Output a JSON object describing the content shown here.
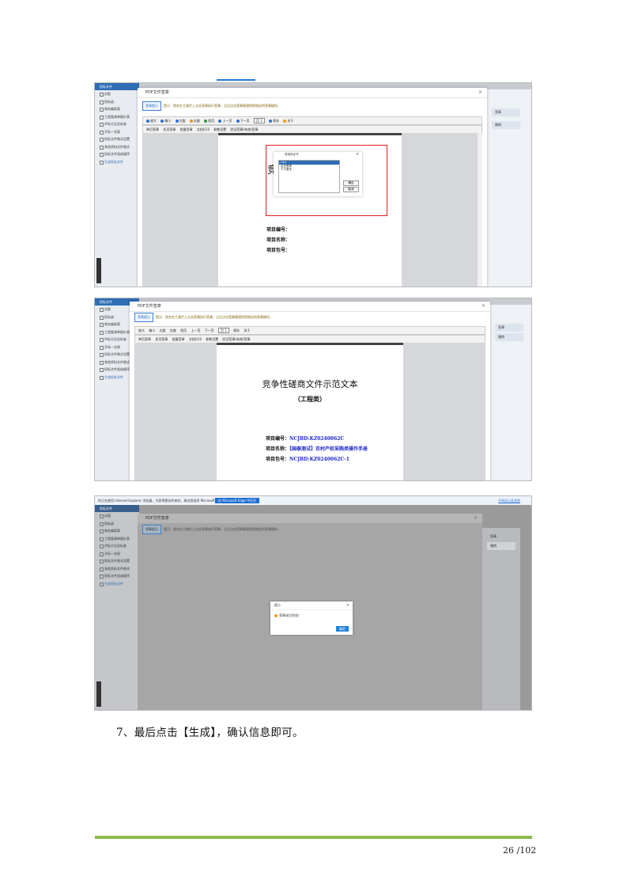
{
  "shared": {
    "sidebar_header": "投标文件",
    "sidebar_items": [
      "封面",
      "投标函",
      "商务偏离表",
      "工程量清单报价表",
      "评标方法及标准",
      "开标一览表",
      "投标文件格式设置",
      "其他资料文件格式",
      "投标文件组成顺序",
      "生成投标文件"
    ],
    "dialog_title": "PDF文件签章",
    "tip_button": "签章提示",
    "tip_text": "提示：首先在工具栏上点击签章执行签章，之后点击签章管理找到相应的签章操作。",
    "toolbar_row1": [
      "放大",
      "缩小",
      "左旋",
      "右旋",
      "首页",
      "上一页",
      "下一页",
      "末页",
      "保存",
      "关于"
    ],
    "page_select": "页 1",
    "toolbar_row2": [
      "单页签章",
      "多页签章",
      "批量签章",
      "文档打印",
      "参数设置",
      "验证签章(有效)签章"
    ],
    "right_panel_labels": [
      "签章",
      "撤销"
    ]
  },
  "shot1": {
    "cert_select_title": "请选择证书",
    "cert_options": [
      "CA1",
      "企业签章",
      "个人签字"
    ],
    "ok_button": "确定",
    "cancel_button": "取消",
    "partial_title": "竞",
    "project_no_label": "项目编号：",
    "project_name_label": "项目名称：",
    "package_no_label": "项目包号："
  },
  "shot2": {
    "doc_title": "竞争性磋商文件示范文本",
    "doc_subtitle": "（工程类）",
    "project_no_label": "项目编号：",
    "project_no_value": "NCJBD:KZ0240062C",
    "project_name_label": "项目名称：",
    "project_name_value": "【国泰测试】农村产权采购类操作手册",
    "package_no_label": "项目包号：",
    "package_no_value": "NCJBD:KZ0240062C-1"
  },
  "shot3": {
    "browser_bar_text": "你正在使用 Internet Explorer 浏览器，为获得更佳的体验，建议您改用 Microsoft Edge 打开网页。",
    "browser_button": "在 Microsoft Edge 中打开",
    "browser_link": "不再显示此消息",
    "msg_title": "提示",
    "msg_text": "签章成功完成！",
    "msg_ok": "确定",
    "right_label": "签章",
    "right_button": "撤销"
  },
  "caption": "7、最后点击【生成】，确认信息即可。",
  "page_number": "26 /102"
}
